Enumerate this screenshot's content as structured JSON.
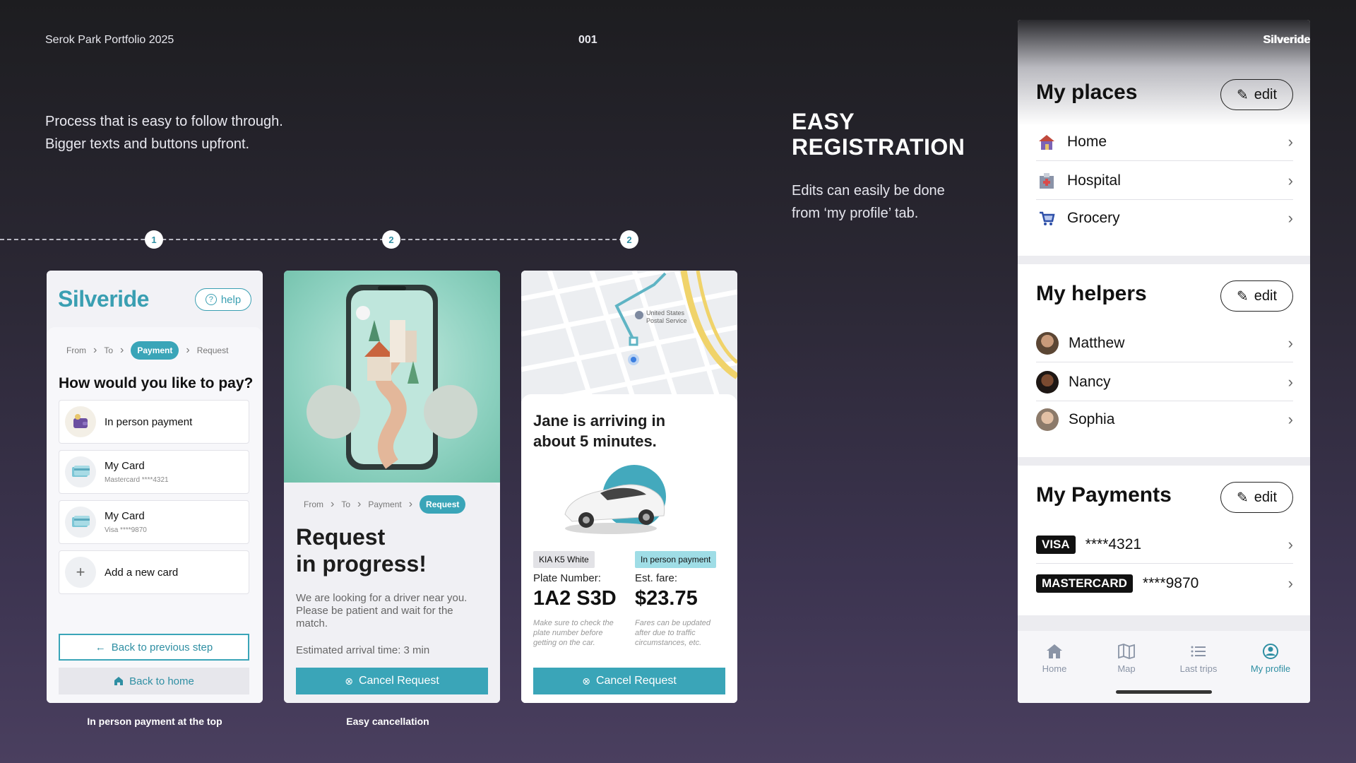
{
  "header": {
    "left": "Serok Park Portfolio 2025",
    "center": "001",
    "right": "Silveride"
  },
  "intro": "Process that is easy to follow through. Bigger texts and buttons upfront.",
  "easy": {
    "title": "EASY REGISTRATION",
    "subtitle": "Edits can easily be done from ‘my profile’ tab."
  },
  "steps": [
    "1",
    "2",
    "2"
  ],
  "captions": [
    "In person payment at the top",
    "Easy cancellation"
  ],
  "phone1": {
    "logo": "Silveride",
    "help": "help",
    "crumbs": [
      "From",
      "To",
      "Payment",
      "Request"
    ],
    "question": "How would you like to pay?",
    "options": [
      {
        "main": "In person payment",
        "sub": ""
      },
      {
        "main": "My Card",
        "sub": "Mastercard ****4321"
      },
      {
        "main": "My Card",
        "sub": "Visa ****9870"
      },
      {
        "main": "Add a new card",
        "sub": ""
      }
    ],
    "back_step": "Back to previous step",
    "back_home": "Back to home"
  },
  "phone2": {
    "crumbs": [
      "From",
      "To",
      "Payment",
      "Request"
    ],
    "title_line1": "Request",
    "title_line2": "in progress!",
    "text": "We are looking for a driver near you. Please be patient and wait for the match.",
    "eta": "Estimated arrival time: 3 min",
    "cancel": "Cancel Request"
  },
  "phone3": {
    "map_label": "United States Postal Service",
    "title": "Jane is arriving in about 5 minutes.",
    "car_tag": "KIA K5 White",
    "pay_tag": "In person payment",
    "plate_label": "Plate Number:",
    "plate": "1A2 S3D",
    "fare_label": "Est. fare:",
    "fare": "$23.75",
    "plate_note": "Make sure to check the plate number before getting on the car.",
    "fare_note": "Fares can be updated after due to traffic circumstances, etc.",
    "cancel": "Cancel Request"
  },
  "panel": {
    "places_title": "My places",
    "edit": "edit",
    "places": [
      "Home",
      "Hospital",
      "Grocery"
    ],
    "helpers_title": "My helpers",
    "helpers": [
      "Matthew",
      "Nancy",
      "Sophia"
    ],
    "payments_title": "My Payments",
    "payments": [
      {
        "brand": "VISA",
        "number": "****4321"
      },
      {
        "brand": "MASTERCARD",
        "number": "****9870"
      }
    ],
    "nav": [
      {
        "label": "Home",
        "icon": "home-icon"
      },
      {
        "label": "Map",
        "icon": "map-icon"
      },
      {
        "label": "Last trips",
        "icon": "list-icon"
      },
      {
        "label": "My profile",
        "icon": "profile-icon"
      }
    ]
  },
  "colors": {
    "accent": "#3aa5b8",
    "background": "#2a2733",
    "text_dark": "#111111"
  }
}
